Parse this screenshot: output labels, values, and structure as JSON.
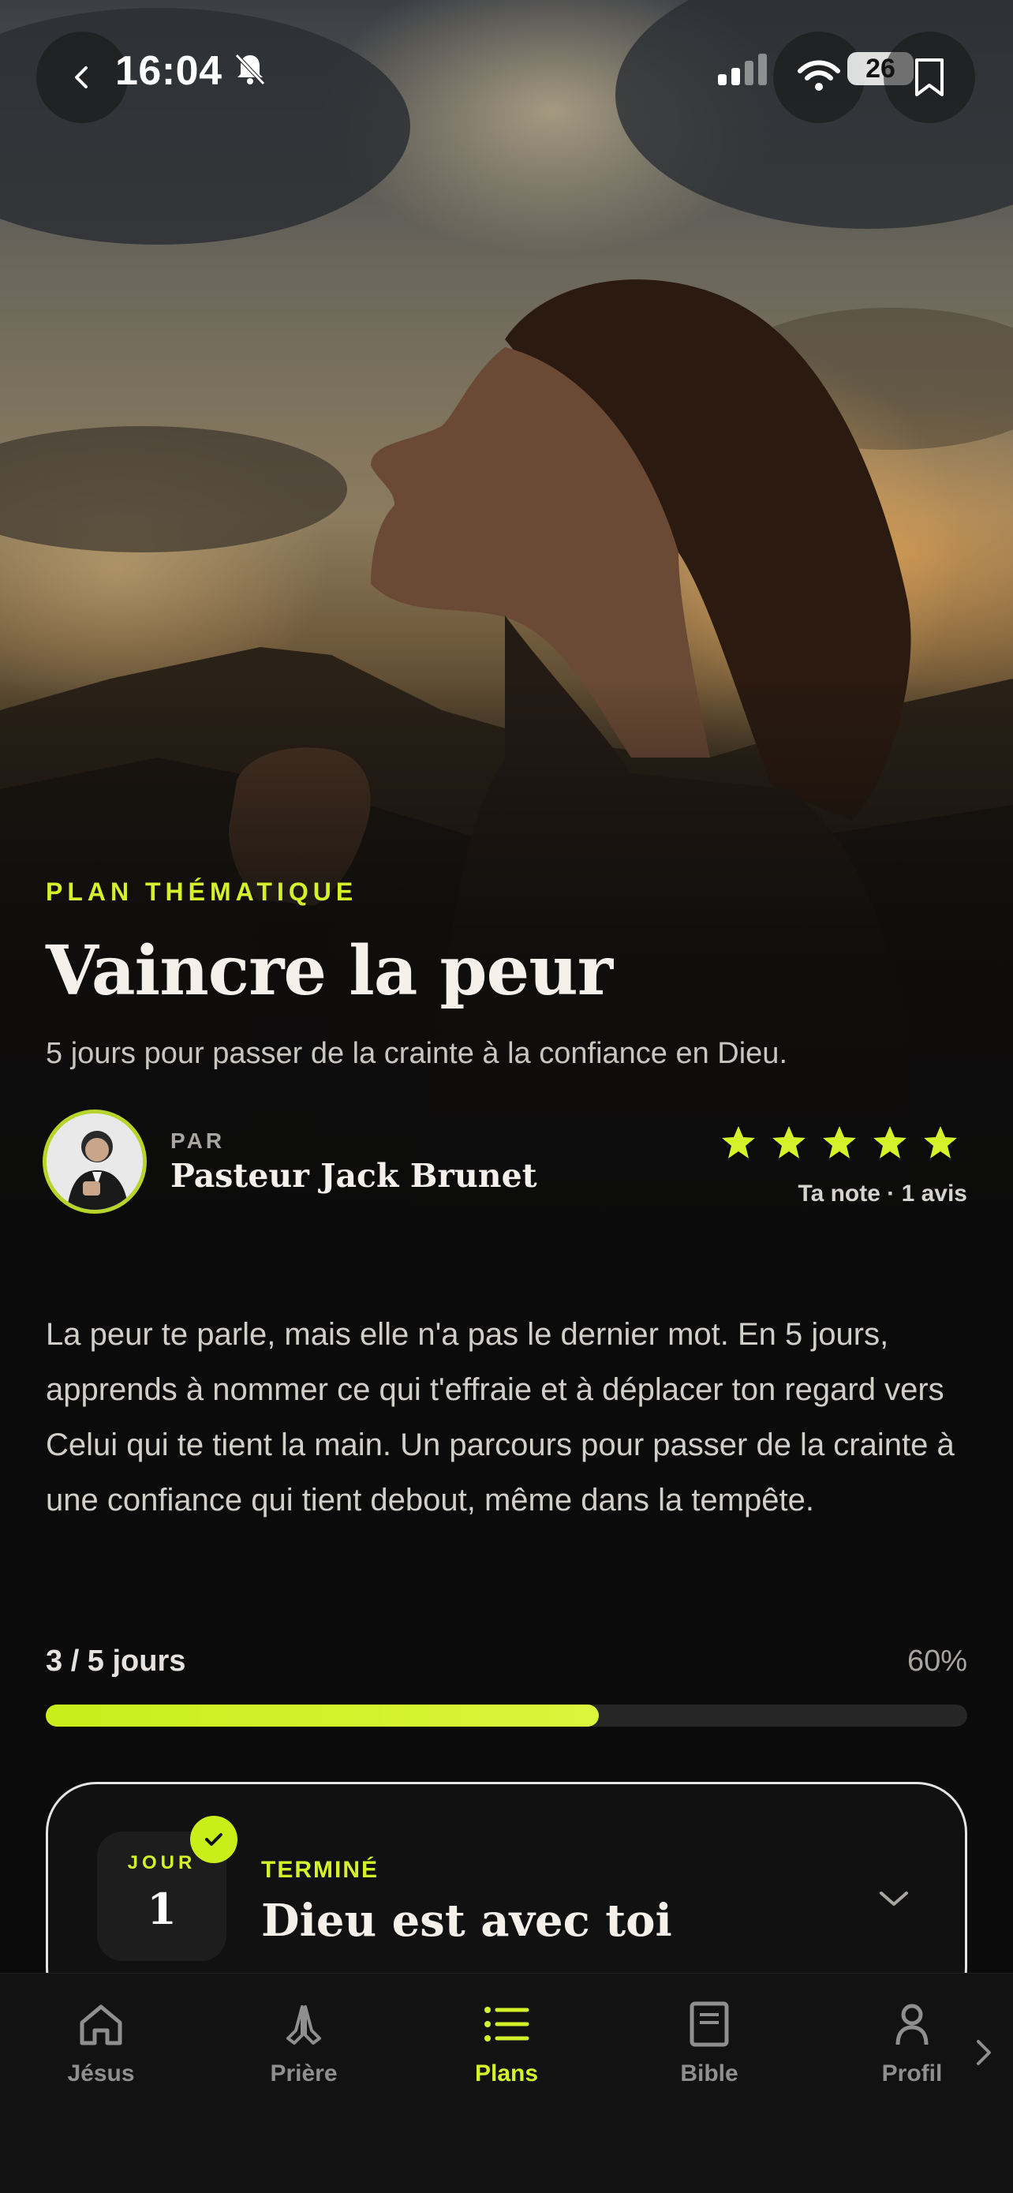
{
  "status_bar": {
    "time": "16:04",
    "battery": "26"
  },
  "plan": {
    "kicker": "PLAN THÉMATIQUE",
    "title": "Vaincre la peur",
    "subtitle": "5 jours pour passer de la crainte à la confiance en Dieu.",
    "author_prefix": "PAR",
    "author_name": "Pasteur Jack Brunet",
    "rating_value": 5,
    "rating_max": 5,
    "rating_text": "Ta note · 1 avis",
    "description": "La peur te parle, mais elle n'a pas le dernier mot. En 5 jours, apprends à nommer ce qui t'effraie et à déplacer ton regard vers Celui qui te tient la main. Un parcours pour passer de la crainte à une confiance qui tient debout, même dans la tempête."
  },
  "progress": {
    "label": "3 / 5 jours",
    "percent_text": "60%",
    "fraction": 0.6
  },
  "day_card": {
    "day_label": "JOUR",
    "day_number": "1",
    "status": "TERMINÉ",
    "title": "Dieu est avec toi"
  },
  "tabs": [
    {
      "label": "Jésus",
      "icon": "home-icon",
      "active": false
    },
    {
      "label": "Prière",
      "icon": "praying-hands-icon",
      "active": false
    },
    {
      "label": "Plans",
      "icon": "list-icon",
      "active": true
    },
    {
      "label": "Bible",
      "icon": "book-icon",
      "active": false
    },
    {
      "label": "Profil",
      "icon": "person-icon",
      "active": false
    }
  ],
  "colors": {
    "accent": "#d4f22a",
    "background": "#0b0b0b",
    "card_border": "#e5e5e5"
  }
}
